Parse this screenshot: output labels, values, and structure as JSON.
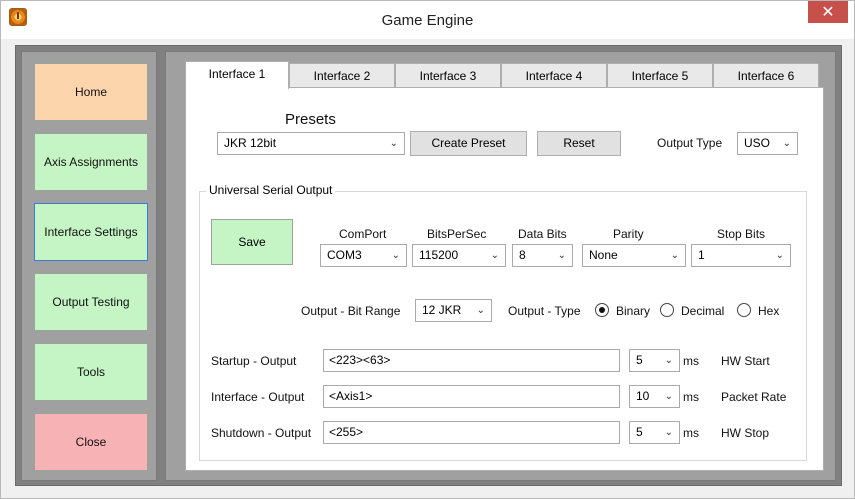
{
  "window": {
    "title": "Game Engine",
    "close_glyph": "✕",
    "icon": "app-power-icon"
  },
  "sidebar": {
    "items": [
      {
        "label": "Home"
      },
      {
        "label": "Axis Assignments"
      },
      {
        "label": "Interface Settings"
      },
      {
        "label": "Output Testing"
      },
      {
        "label": "Tools"
      },
      {
        "label": "Close"
      }
    ],
    "colors": {
      "home": "#fdd5ad",
      "green": "#c5f5c5",
      "close": "#f7b2b5"
    }
  },
  "tabs": [
    {
      "label": "Interface 1"
    },
    {
      "label": "Interface 2"
    },
    {
      "label": "Interface 3"
    },
    {
      "label": "Interface 4"
    },
    {
      "label": "Interface 5"
    },
    {
      "label": "Interface 6"
    }
  ],
  "presets": {
    "heading": "Presets",
    "selected": "JKR 12bit",
    "create_label": "Create Preset",
    "reset_label": "Reset",
    "output_type_label": "Output Type",
    "output_type_value": "USO"
  },
  "uso": {
    "group_title": "Universal Serial Output",
    "save_label": "Save",
    "comport": {
      "label": "ComPort",
      "value": "COM3"
    },
    "bitspersec": {
      "label": "BitsPerSec",
      "value": "115200"
    },
    "databits": {
      "label": "Data Bits",
      "value": "8"
    },
    "parity": {
      "label": "Parity",
      "value": "None"
    },
    "stopbits": {
      "label": "Stop Bits",
      "value": "1"
    },
    "bitrange": {
      "label": "Output - Bit Range",
      "value": "12 JKR"
    },
    "outtype": {
      "label": "Output - Type",
      "options": [
        "Binary",
        "Decimal",
        "Hex"
      ],
      "selected": "Binary"
    },
    "rows": [
      {
        "label": "Startup - Output",
        "value": "<223><63>",
        "num": "5",
        "unit": "ms",
        "note": "HW Start"
      },
      {
        "label": "Interface - Output",
        "value": "<Axis1>",
        "num": "10",
        "unit": "ms",
        "note": "Packet Rate"
      },
      {
        "label": "Shutdown - Output",
        "value": "<255>",
        "num": "5",
        "unit": "ms",
        "note": "HW Stop"
      }
    ]
  }
}
